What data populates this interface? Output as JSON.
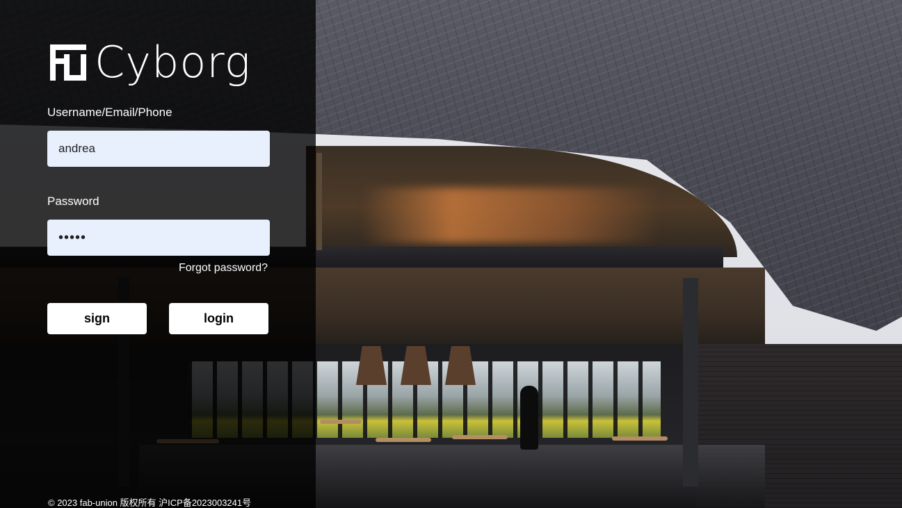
{
  "brand": {
    "logo_icon": "fu-logo-icon",
    "name": "Cyborg"
  },
  "form": {
    "username_label": "Username/Email/Phone",
    "username_value": "andrea",
    "password_label": "Password",
    "password_value": "•••••",
    "forgot_link": "Forgot password?",
    "sign_button": "sign",
    "login_button": "login"
  },
  "footer": {
    "copyright": "© 2023 fab-union 版权所有 沪ICP备2023003241号"
  },
  "colors": {
    "panel_overlay": "#000000",
    "input_background": "#e8f0fe",
    "button_background": "#ffffff",
    "text": "#ffffff"
  }
}
